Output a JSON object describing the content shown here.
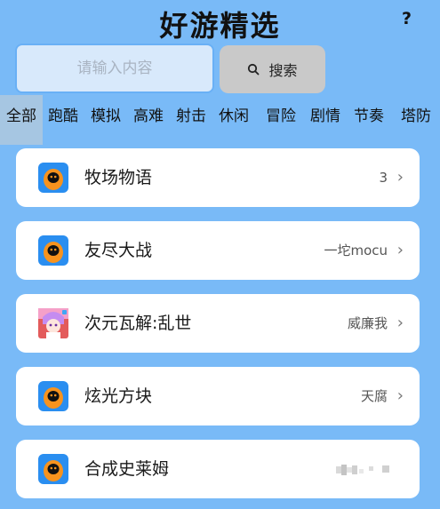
{
  "header": {
    "title": "好游精选",
    "help_label": "?"
  },
  "search": {
    "placeholder": "请输入内容",
    "value": "",
    "button_label": "搜索"
  },
  "tabs": [
    {
      "label": "全部",
      "active": true
    },
    {
      "label": "跑酷",
      "active": false
    },
    {
      "label": "模拟",
      "active": false
    },
    {
      "label": "高难",
      "active": false
    },
    {
      "label": "射击",
      "active": false
    },
    {
      "label": "休闲",
      "active": false
    },
    {
      "label": "冒险",
      "active": false
    },
    {
      "label": "剧情",
      "active": false
    },
    {
      "label": "节奏",
      "active": false
    },
    {
      "label": "塔防",
      "active": false
    }
  ],
  "games": [
    {
      "name": "牧场物语",
      "meta": "3",
      "icon": "orange-mascot-icon"
    },
    {
      "name": "友尽大战",
      "meta": "一坨mocu",
      "icon": "orange-mascot-icon"
    },
    {
      "name": "次元瓦解:乱世",
      "meta": "威廉我",
      "icon": "anime-character-icon"
    },
    {
      "name": "炫光方块",
      "meta": "天腐",
      "icon": "orange-mascot-icon"
    },
    {
      "name": "合成史莱姆",
      "meta": "",
      "icon": "orange-mascot-icon"
    }
  ],
  "chevron": "›",
  "colors": {
    "background": "#79baf7",
    "active_tab": "#a6c6e2",
    "card": "#ffffff",
    "search_button": "#c9c9c9",
    "mascot_orange": "#f7931e",
    "mascot_blue": "#2a8ef0"
  }
}
